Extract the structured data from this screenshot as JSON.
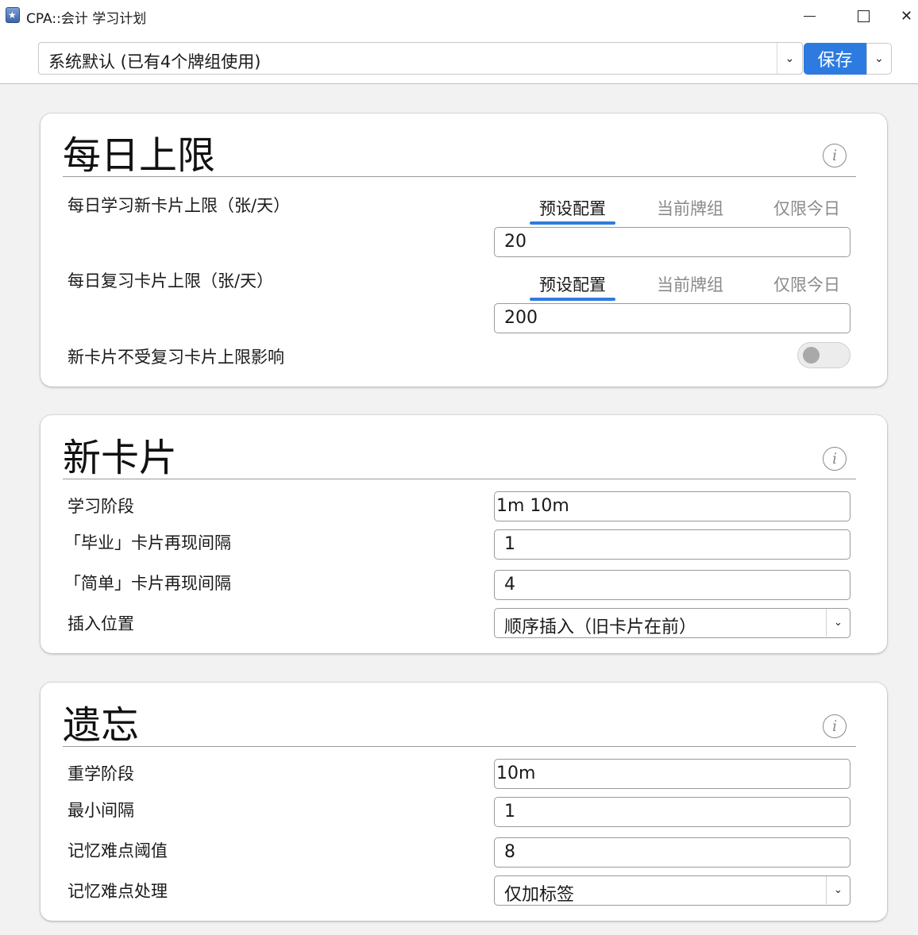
{
  "window": {
    "title": "CPA::会计 学习计划",
    "controls": {
      "minimize": "minimize-icon",
      "maximize": "maximize-icon",
      "close": "✕"
    }
  },
  "preset": {
    "selected": "系统默认 (已有4个牌组使用)",
    "save_label": "保存"
  },
  "tabs": {
    "preset": "预设配置",
    "deck": "当前牌组",
    "today": "仅限今日"
  },
  "daily_limits": {
    "title": "每日上限",
    "new_limit_label": "每日学习新卡片上限（张/天）",
    "new_limit_value": "20",
    "review_limit_label": "每日复习卡片上限（张/天）",
    "review_limit_value": "200",
    "new_ignore_review_label": "新卡片不受复习卡片上限影响",
    "new_ignore_review_on": false
  },
  "new_cards": {
    "title": "新卡片",
    "learning_steps_label": "学习阶段",
    "learning_steps_value": "1m 10m",
    "graduating_interval_label": "「毕业」卡片再现间隔",
    "graduating_interval_value": "1",
    "easy_interval_label": "「简单」卡片再现间隔",
    "easy_interval_value": "4",
    "insertion_order_label": "插入位置",
    "insertion_order_value": "顺序插入（旧卡片在前）"
  },
  "lapses": {
    "title": "遗忘",
    "relearning_steps_label": "重学阶段",
    "relearning_steps_value": "10m",
    "minimum_interval_label": "最小间隔",
    "minimum_interval_value": "1",
    "leech_threshold_label": "记忆难点阈值",
    "leech_threshold_value": "8",
    "leech_action_label": "记忆难点处理",
    "leech_action_value": "仅加标签"
  },
  "accent_color": "#2d7be0"
}
